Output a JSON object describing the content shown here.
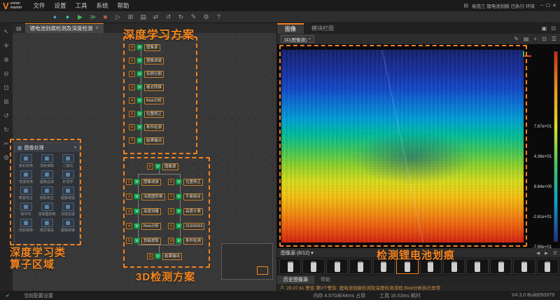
{
  "titlebar": {
    "logo_letter": "V",
    "brand_top": "vision",
    "brand_bottom": "master",
    "menu": [
      "文件",
      "设置",
      "工具",
      "系统",
      "帮助"
    ],
    "scheme_icon": "▤",
    "right_status": "易佰三 锂电池划痕 已执行 环保",
    "window_controls": [
      "─",
      "☐",
      "✕"
    ]
  },
  "toolbar": {
    "icons": [
      {
        "name": "camera-connect-icon",
        "glyph": "●",
        "color": "#38a6d8"
      },
      {
        "name": "camera-live-icon",
        "glyph": "●",
        "color": "#2fc2a8"
      },
      {
        "name": "run-once-icon",
        "glyph": "▶",
        "color": "#4cb85c"
      },
      {
        "name": "run-all-icon",
        "glyph": "≫",
        "color": "#4cb85c"
      },
      {
        "name": "stop-icon",
        "glyph": "■",
        "color": "#c05a50"
      },
      {
        "name": "step-icon",
        "glyph": "▷",
        "color": "#9a9a9a"
      },
      {
        "name": "grid-view-icon",
        "glyph": "⊞",
        "color": "#9a9a9a"
      },
      {
        "name": "layout-icon",
        "glyph": "▤",
        "color": "#9a9a9a"
      },
      {
        "name": "swap-icon",
        "glyph": "⇄",
        "color": "#9a9a9a"
      },
      {
        "name": "undo-icon",
        "glyph": "↺",
        "color": "#9a9a9a"
      },
      {
        "name": "redo-icon",
        "glyph": "↻",
        "color": "#9a9a9a"
      },
      {
        "name": "edit-icon",
        "glyph": "✎",
        "color": "#9a9a9a"
      },
      {
        "name": "settings-gear-icon",
        "glyph": "⚙",
        "color": "#9a9a9a"
      },
      {
        "name": "help-icon",
        "glyph": "?",
        "color": "#9a9a9a"
      }
    ]
  },
  "left_strip": {
    "icons": [
      {
        "name": "cursor-icon",
        "glyph": "↖"
      },
      {
        "name": "pan-icon",
        "glyph": "✛"
      },
      {
        "name": "zoom-in-icon",
        "glyph": "⊕"
      },
      {
        "name": "zoom-out-icon",
        "glyph": "⊖"
      },
      {
        "name": "fit-view-icon",
        "glyph": "⊡"
      },
      {
        "name": "grid-icon",
        "glyph": "⊞"
      },
      {
        "name": "undo-icon",
        "glyph": "↺"
      },
      {
        "name": "redo-icon",
        "glyph": "↻"
      },
      {
        "name": "snip-icon",
        "glyph": "✂"
      },
      {
        "name": "settings-icon",
        "glyph": "⚙"
      }
    ]
  },
  "canvas": {
    "menu_icon": "▤",
    "tab": "锂电池划痕检测及深度检测",
    "tab_close": "×"
  },
  "palette": {
    "header": "图像处理",
    "collapse_icon": "▾",
    "items": [
      "色彩变换",
      "浅色抽取",
      "二值化",
      "亮度变换",
      "图像滤波",
      "形态学",
      "畸变校正",
      "阴影校正",
      "图像增强",
      "帧平均",
      "深度图转换",
      "深度滤波",
      "仿射变换",
      "拷贝填充",
      "图像拼接"
    ]
  },
  "flow": {
    "top": {
      "nodes": [
        {
          "num": "0",
          "label": "图像源"
        },
        {
          "num": "1",
          "label": "图像滤波"
        },
        {
          "num": "2",
          "label": "实例分割"
        },
        {
          "num": "3",
          "label": "格式转换"
        },
        {
          "num": "4",
          "label": "Blob分析"
        },
        {
          "num": "5",
          "label": "位置修正"
        },
        {
          "num": "6",
          "label": "条件检测"
        },
        {
          "num": "7",
          "label": "结果输出"
        }
      ]
    },
    "bottom": {
      "head": {
        "num": "0",
        "label": "图像源"
      },
      "left": [
        {
          "num": "1",
          "label": "图像滤波"
        },
        {
          "num": "2",
          "label": "深度图转换"
        },
        {
          "num": "3",
          "label": "高度测量"
        },
        {
          "num": "4",
          "label": "Blob分析"
        },
        {
          "num": "5",
          "label": "划痕提取"
        }
      ],
      "right": [
        {
          "num": "6",
          "label": "位置修正"
        },
        {
          "num": "7",
          "label": "平面拟合"
        },
        {
          "num": "8",
          "label": "高度计算"
        },
        {
          "num": "9",
          "label": "21000063"
        },
        {
          "num": "10",
          "label": "条件检测"
        }
      ],
      "tail": {
        "num": "11",
        "label": "结果输出"
      }
    }
  },
  "viewer": {
    "tabs": [
      "图像",
      "模块栏图"
    ],
    "active_tab": 0,
    "tab_icons": [
      {
        "name": "pin-icon",
        "glyph": "▣"
      },
      {
        "name": "expand-icon",
        "glyph": "⊡"
      }
    ],
    "source_dropdown": "3D(图像源)",
    "toolbar_icons": [
      {
        "name": "edit-icon",
        "glyph": "✎"
      },
      {
        "name": "layers-icon",
        "glyph": "▤"
      },
      {
        "name": "crosshair-icon",
        "glyph": "+"
      },
      {
        "name": "fit-icon",
        "glyph": "⊡"
      },
      {
        "name": "menu-icon",
        "glyph": "☰"
      }
    ],
    "scale_labels": [
      "7.87e+01",
      "4.38e+01",
      "8.64e+00",
      "-2.61e+01",
      "-7.69e+01"
    ],
    "strip_title": "图像源 (6/12)",
    "strip_dropdown_icon": "▾",
    "strip_controls": [
      {
        "name": "prev-image-icon",
        "glyph": "◀"
      },
      {
        "name": "next-image-icon",
        "glyph": "▶"
      },
      {
        "name": "strip-menu-icon",
        "glyph": "☰"
      }
    ],
    "thumbnail_count": 12,
    "selected_thumbnail": 5,
    "bottom_tabs": [
      "历史图像源",
      "帮助"
    ],
    "active_bottom_tab": 0,
    "warning_message": "29.07.61 警告 第0个警告: 锂电池划痕检测及深度检测流程.Blob分析执行异常"
  },
  "annotations": {
    "top_scheme": "深度学习方案",
    "bottom_scheme": "3D检测方案",
    "left_area_line1": "深度学习类",
    "left_area_line2": "算子区域",
    "right_label": "检测锂电池划痕"
  },
  "statusbar": {
    "config_label": "当前配置设置",
    "memory": "内存 4.57GB/44ms 占用",
    "tool_time": "工具 16.53ms 耗时",
    "version": "V4.3.0 Build050979"
  },
  "colors": {
    "accent_orange": "#f5821f",
    "node_green": "#23a858"
  }
}
